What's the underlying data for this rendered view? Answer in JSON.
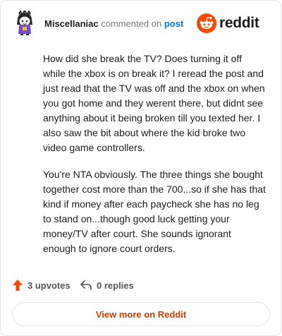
{
  "header": {
    "username": "Miscellaniac",
    "commented_on_text": "commented on",
    "post_link_label": "post",
    "logo_word": "reddit"
  },
  "comment": {
    "paragraphs": [
      "How did she break the TV? Does turning it off while the xbox is on break it? I reread the post and just read that the TV was off and the xbox on when you got home and they werent there, but didnt see anything about it being broken till you texted her. I also saw the bit about where the kid broke two video game controllers.",
      "You're NTA obviously. The three things she bought together cost more than the 700...so if she has that kind if money after each paycheck she has no leg to stand on...though good luck getting your money/TV after court. She sounds ignorant enough to ignore court orders."
    ]
  },
  "footer": {
    "upvotes_label": "3 upvotes",
    "replies_label": "0 replies",
    "cta_label": "View more on Reddit"
  },
  "colors": {
    "brand": "#ff4500",
    "link": "#0079d3",
    "cta_text": "#d93a00"
  },
  "icons": {
    "avatar": "snoo-avatar",
    "logo": "reddit-snoo-icon",
    "upvote": "upvote-arrow-icon",
    "reply": "reply-arrow-icon"
  }
}
